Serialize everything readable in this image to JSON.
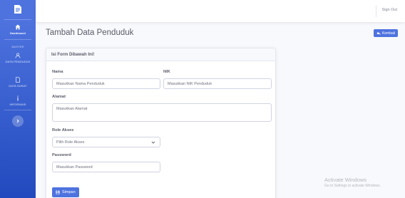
{
  "sidebar": {
    "items": [
      {
        "label": "Dashboard",
        "icon": "home-icon"
      },
      {
        "label": "DATA PENDUDUK",
        "icon": "users-icon"
      },
      {
        "label": "DATA SURAT",
        "icon": "file-icon"
      },
      {
        "label": "INFORMASI",
        "icon": "info-icon"
      }
    ],
    "heading": "MASTER"
  },
  "topbar": {
    "signout_label": "Sign Out"
  },
  "page": {
    "title": "Tambah Data Penduduk",
    "back_label": "Kembali"
  },
  "form": {
    "card_title": "Isi Form Dibawah Ini!",
    "nama_label": "Nama",
    "nama_placeholder": "Masukkan Nama Penduduk",
    "nik_label": "NIK",
    "nik_placeholder": "Masukkan NIK Penduduk",
    "alamat_label": "Alamat",
    "alamat_placeholder": "Masukkan Alamat",
    "role_label": "Role Akses",
    "role_selected": "Pilih Role Akses",
    "password_label": "Password",
    "password_placeholder": "Masukkan Password",
    "save_label": "Simpan"
  },
  "watermark": {
    "title": "Activate Windows",
    "subtitle": "Go to Settings to activate Windows."
  },
  "colors": {
    "primary": "#4e73df",
    "sidebar_dark": "#224abe",
    "bg": "#f8f9fc"
  }
}
